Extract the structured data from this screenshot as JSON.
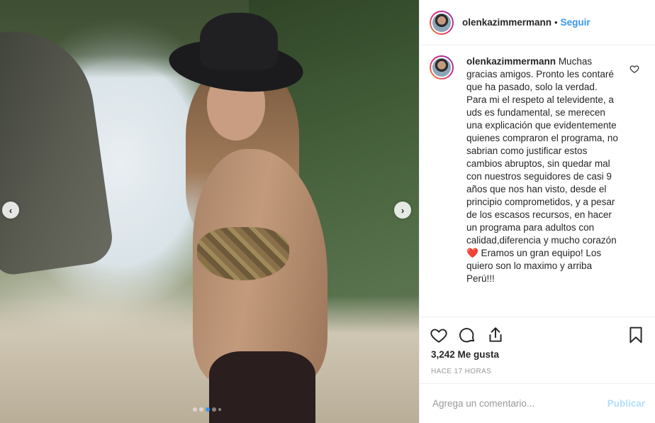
{
  "post": {
    "username": "olenkazimmermann",
    "follow_label": "Seguir",
    "bullet": "•",
    "caption": "Muchas gracias amigos. Pronto les contaré que ha pasado, solo la verdad. Para mi el respeto al televidente, a uds es fundamental, se merecen una explicación que evidentemente quienes compraron el programa, no sabrian como justificar estos cambios abruptos, sin quedar mal con nuestros seguidores de casi 9 años que nos han visto, desde el principio comprometidos, y a pesar de los escasos recursos, en hacer un programa para adultos con calidad,diferencia y mucho corazón❤️ Eramos un gran equipo! Los quiero son lo maximo y arriba Perú!!!",
    "likes": "3,242 Me gusta",
    "timestamp": "HACE 17 HORAS"
  },
  "comment_form": {
    "placeholder": "Agrega un comentario...",
    "publish_label": "Publicar"
  },
  "carousel": {
    "total_slides": 5,
    "active_index": 2,
    "prev_glyph": "‹",
    "next_glyph": "›"
  },
  "colors": {
    "accent": "#3897f0",
    "publish_disabled": "#b2dffc"
  },
  "icons": [
    "heart-icon",
    "comment-icon",
    "share-icon",
    "bookmark-icon",
    "chevron-left-icon",
    "chevron-right-icon"
  ]
}
